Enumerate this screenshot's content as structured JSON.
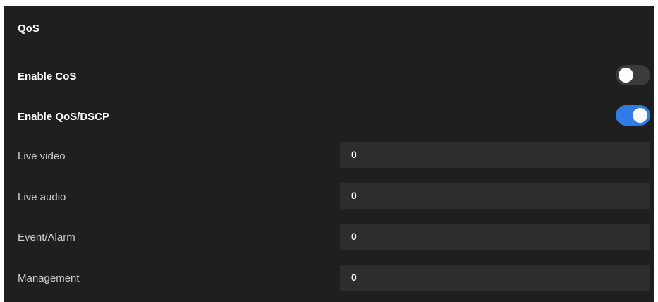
{
  "section": {
    "title": "QoS"
  },
  "toggles": {
    "cos": {
      "label": "Enable CoS",
      "enabled": false
    },
    "qos_dscp": {
      "label": "Enable QoS/DSCP",
      "enabled": true
    }
  },
  "fields": [
    {
      "label": "Live video",
      "value": "0"
    },
    {
      "label": "Live audio",
      "value": "0"
    },
    {
      "label": "Event/Alarm",
      "value": "0"
    },
    {
      "label": "Management",
      "value": "0"
    }
  ],
  "colors": {
    "panel_bg": "#1f1f1f",
    "toggle_on": "#2f7be8",
    "toggle_off": "#3b3b3b",
    "field_bg": "#2d2d2d"
  }
}
